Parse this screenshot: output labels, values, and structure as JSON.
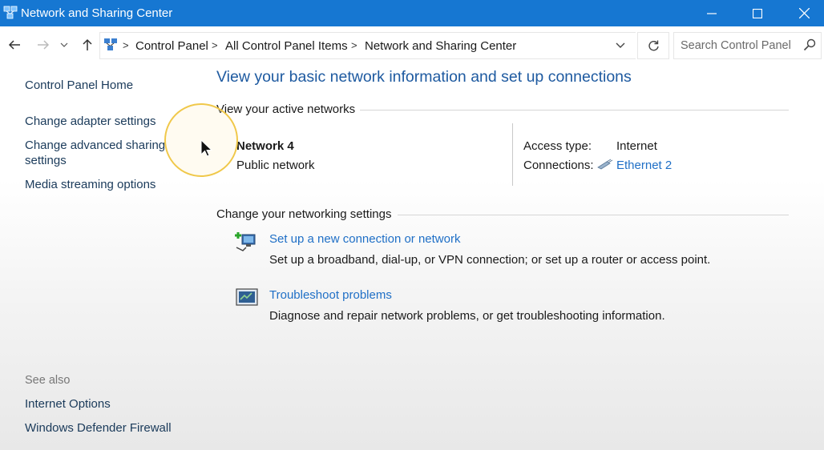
{
  "window": {
    "title": "Network and Sharing Center",
    "accent_color": "#1677d2",
    "controls": {
      "minimize_icon": "minimize-icon",
      "maximize_icon": "maximize-icon",
      "close_icon": "close-icon"
    }
  },
  "navigation": {
    "back_icon": "back-arrow-icon",
    "forward_icon": "forward-arrow-icon",
    "recent_icon": "chevron-down-icon",
    "up_icon": "up-arrow-icon",
    "breadcrumb": [
      "Control Panel",
      "All Control Panel Items",
      "Network and Sharing Center"
    ],
    "separator": ">",
    "refresh_icon": "refresh-icon",
    "search_placeholder": "Search Control Panel"
  },
  "sidebar": {
    "home": "Control Panel Home",
    "links": [
      "Change adapter settings",
      "Change advanced sharing",
      "settings",
      "Media streaming options"
    ],
    "see_also_label": "See also",
    "see_also": [
      "Internet Options",
      "Windows Defender Firewall"
    ]
  },
  "main": {
    "title": "View your basic network information and set up connections",
    "active_networks_label": "View your active networks",
    "network": {
      "name": "Network 4",
      "type": "Public network",
      "access_type_label": "Access type:",
      "access_type_value": "Internet",
      "connections_label": "Connections:",
      "connections_value": "Ethernet 2"
    },
    "change_settings_label": "Change your networking settings",
    "tasks": [
      {
        "link": "Set up a new connection or network",
        "desc": "Set up a broadband, dial-up, or VPN connection; or set up a router or access point.",
        "icon": "new-connection-icon"
      },
      {
        "link": "Troubleshoot problems",
        "desc": "Diagnose and repair network problems, or get troubleshooting information.",
        "icon": "troubleshoot-icon"
      }
    ]
  }
}
